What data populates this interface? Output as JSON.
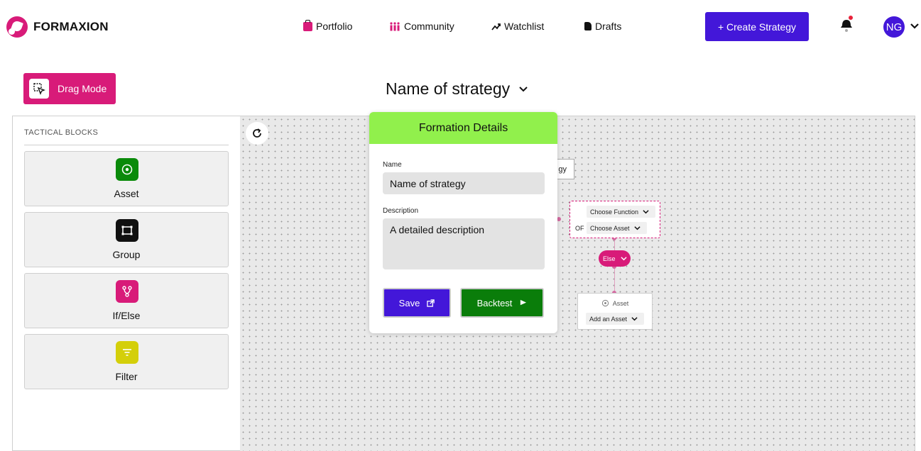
{
  "brand": {
    "name": "FORMAXION"
  },
  "nav": {
    "portfolio": "Portfolio",
    "community": "Community",
    "watchlist": "Watchlist",
    "drafts": "Drafts"
  },
  "header": {
    "create_label": "+ Create Strategy",
    "avatar_initials": "NG"
  },
  "toolbar": {
    "drag_mode_label": "Drag Mode"
  },
  "strategy": {
    "title": "Name of strategy"
  },
  "tactical_blocks": {
    "title": "TACTICAL BLOCKS",
    "items": [
      {
        "label": "Asset",
        "icon": "target-icon",
        "color": "#0a8a0a"
      },
      {
        "label": "Group",
        "icon": "group-icon",
        "color": "#111111"
      },
      {
        "label": "If/Else",
        "icon": "branch-icon",
        "color": "#d81b79"
      },
      {
        "label": "Filter",
        "icon": "filter-icon",
        "color": "#d4cf0a"
      }
    ]
  },
  "canvas": {
    "behind_node_text": "gy",
    "function_node": {
      "function_select": "Choose Function",
      "of_label": "OF",
      "asset_select": "Choose Asset"
    },
    "else_label": "Else",
    "asset_node": {
      "title": "Asset",
      "select": "Add an Asset"
    }
  },
  "modal": {
    "title": "Formation Details",
    "name_label": "Name",
    "name_value": "Name of strategy",
    "description_label": "Description",
    "description_value": "A detailed description",
    "save_label": "Save",
    "backtest_label": "Backtest"
  },
  "colors": {
    "brand_pink": "#d81b79",
    "brand_purple": "#4317d9",
    "modal_header": "#91f04c",
    "backtest_green": "#0a7d0a"
  }
}
